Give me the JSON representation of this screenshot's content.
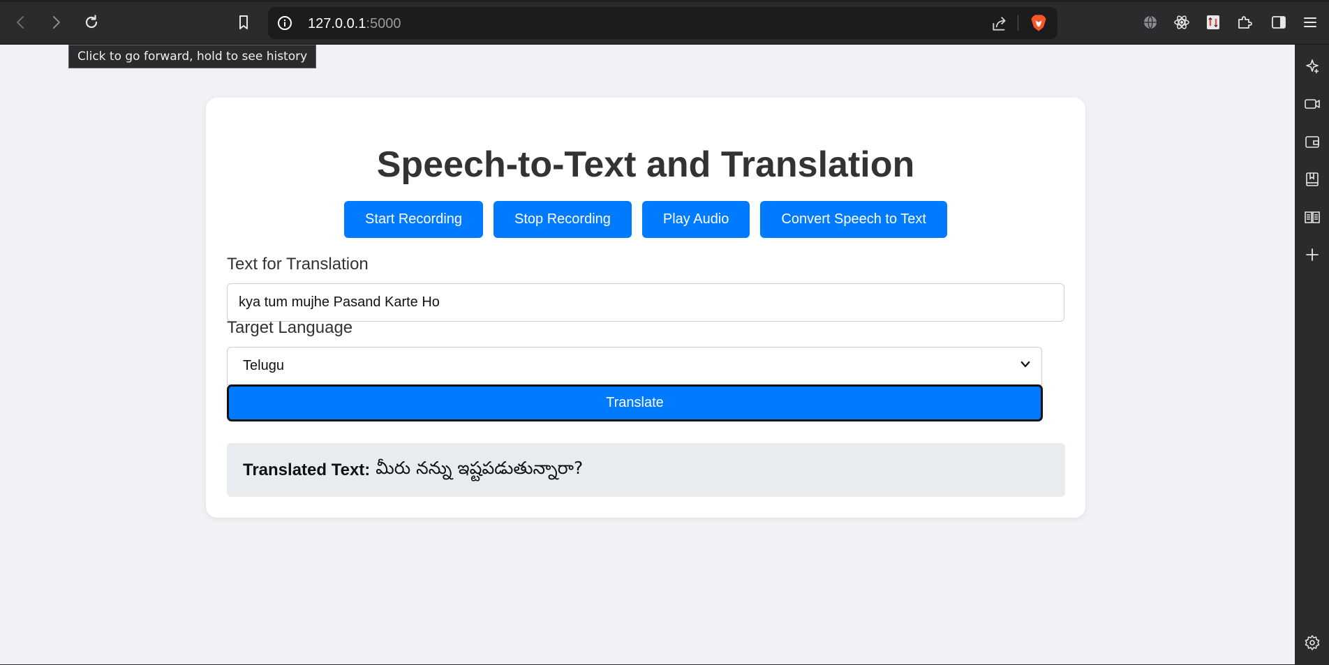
{
  "browser": {
    "url_host": "127.0.0.1",
    "url_port": ":5000",
    "tooltip": "Click to go forward, hold to see history"
  },
  "page": {
    "title": "Speech-to-Text and Translation",
    "buttons": {
      "start": "Start Recording",
      "stop": "Stop Recording",
      "play": "Play Audio",
      "convert": "Convert Speech to Text"
    },
    "text_label": "Text for Translation",
    "text_value": "kya tum mujhe Pasand Karte Ho",
    "language_label": "Target Language",
    "language_selected": "Telugu",
    "translate_button": "Translate",
    "result_label": "Translated Text:",
    "result_value": "మీరు నన్ను ఇష్టపడుతున్నారా?"
  },
  "colors": {
    "accent": "#007bff",
    "page_bg": "#f0f2f5",
    "result_bg": "#e9ecef",
    "brave": "#fb542b"
  }
}
